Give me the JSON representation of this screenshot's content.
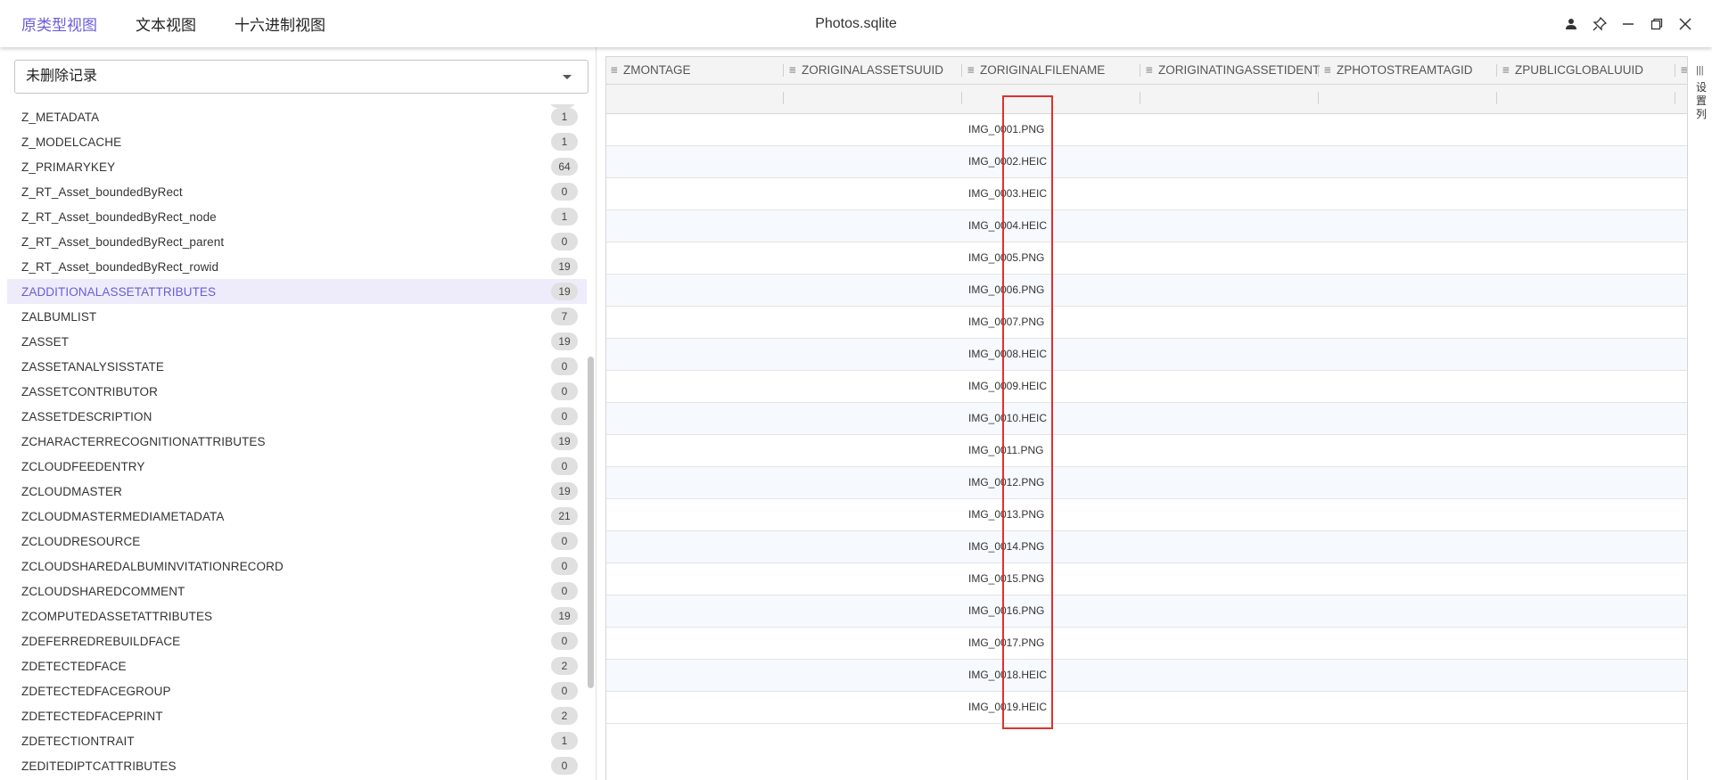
{
  "tabs": [
    "原类型视图",
    "文本视图",
    "十六进制视图"
  ],
  "active_tab": 0,
  "title": "Photos.sqlite",
  "filter_select": {
    "value": "未删除记录"
  },
  "tables": [
    {
      "name": "Z_METADATA",
      "count": "1"
    },
    {
      "name": "Z_MODELCACHE",
      "count": "1"
    },
    {
      "name": "Z_PRIMARYKEY",
      "count": "64"
    },
    {
      "name": "Z_RT_Asset_boundedByRect",
      "count": "0"
    },
    {
      "name": "Z_RT_Asset_boundedByRect_node",
      "count": "1"
    },
    {
      "name": "Z_RT_Asset_boundedByRect_parent",
      "count": "0"
    },
    {
      "name": "Z_RT_Asset_boundedByRect_rowid",
      "count": "19"
    },
    {
      "name": "ZADDITIONALASSETATTRIBUTES",
      "count": "19",
      "selected": true
    },
    {
      "name": "ZALBUMLIST",
      "count": "7"
    },
    {
      "name": "ZASSET",
      "count": "19"
    },
    {
      "name": "ZASSETANALYSISSTATE",
      "count": "0"
    },
    {
      "name": "ZASSETCONTRIBUTOR",
      "count": "0"
    },
    {
      "name": "ZASSETDESCRIPTION",
      "count": "0"
    },
    {
      "name": "ZCHARACTERRECOGNITIONATTRIBUTES",
      "count": "19"
    },
    {
      "name": "ZCLOUDFEEDENTRY",
      "count": "0"
    },
    {
      "name": "ZCLOUDMASTER",
      "count": "19"
    },
    {
      "name": "ZCLOUDMASTERMEDIAMETADATA",
      "count": "21"
    },
    {
      "name": "ZCLOUDRESOURCE",
      "count": "0"
    },
    {
      "name": "ZCLOUDSHAREDALBUMINVITATIONRECORD",
      "count": "0"
    },
    {
      "name": "ZCLOUDSHAREDCOMMENT",
      "count": "0"
    },
    {
      "name": "ZCOMPUTEDASSETATTRIBUTES",
      "count": "19"
    },
    {
      "name": "ZDEFERREDREBUILDFACE",
      "count": "0"
    },
    {
      "name": "ZDETECTEDFACE",
      "count": "2"
    },
    {
      "name": "ZDETECTEDFACEGROUP",
      "count": "0"
    },
    {
      "name": "ZDETECTEDFACEPRINT",
      "count": "2"
    },
    {
      "name": "ZDETECTIONTRAIT",
      "count": "1"
    },
    {
      "name": "ZEDITEDIPTCATTRIBUTES",
      "count": "0"
    }
  ],
  "columns": [
    "ZMONTAGE",
    "ZORIGINALASSETSUUID",
    "ZORIGINALFILENAME",
    "ZORIGINATINGASSETIDENT",
    "ZPHOTOSTREAMTAGID",
    "ZPUBLICGLOBALUUID",
    ""
  ],
  "filenames": [
    "IMG_0001.PNG",
    "IMG_0002.HEIC",
    "IMG_0003.HEIC",
    "IMG_0004.HEIC",
    "IMG_0005.PNG",
    "IMG_0006.PNG",
    "IMG_0007.PNG",
    "IMG_0008.HEIC",
    "IMG_0009.HEIC",
    "IMG_0010.HEIC",
    "IMG_0011.PNG",
    "IMG_0012.PNG",
    "IMG_0013.PNG",
    "IMG_0014.PNG",
    "IMG_0015.PNG",
    "IMG_0016.PNG",
    "IMG_0017.PNG",
    "IMG_0018.HEIC",
    "IMG_0019.HEIC"
  ],
  "side_panel": {
    "label": "设置列"
  },
  "colors": {
    "accent": "#6a5cd8",
    "highlight": "#e03030"
  },
  "icons": {
    "user": "user-icon",
    "pin": "pin-icon",
    "minimize": "minimize-icon",
    "restore": "restore-icon",
    "close": "close-icon"
  }
}
